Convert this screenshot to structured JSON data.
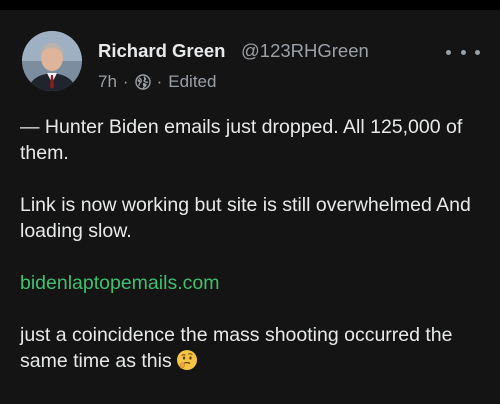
{
  "post": {
    "author": {
      "name": "Richard Green",
      "handle": "@123RHGreen"
    },
    "meta": {
      "time": "7h",
      "separator": "·",
      "visibility_icon": "globe-icon",
      "edited": "Edited"
    },
    "more_icon": "more-horizontal-icon",
    "paragraphs": [
      "— Hunter Biden emails just dropped. All 125,000 of them.",
      "Link is now working but site is still overwhelmed And loading slow."
    ],
    "link": "bidenlaptopemails.com",
    "closing": "just a coincidence the mass shooting occurred the same time as this",
    "closing_emoji": "thinking-face-emoji"
  },
  "colors": {
    "background": "#000000",
    "card": "#141414",
    "text": "#e7e9ea",
    "muted": "#9aa0a6",
    "link": "#3fbf6f"
  }
}
